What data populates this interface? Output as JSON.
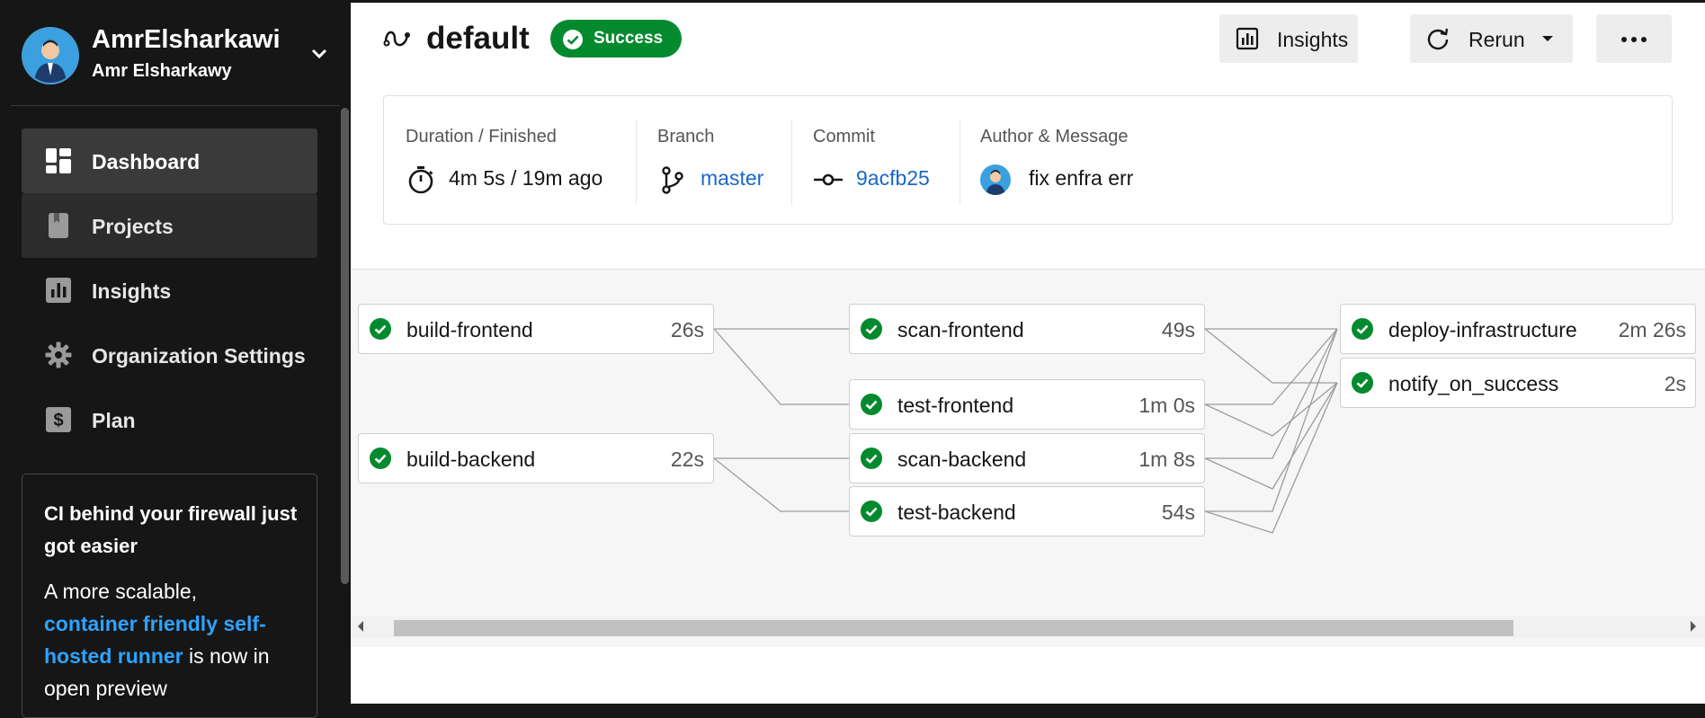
{
  "sidebar": {
    "org_name": "AmrElsharkawi",
    "user_name": "Amr Elsharkawy",
    "nav": [
      {
        "label": "Dashboard",
        "icon": "dashboard-icon"
      },
      {
        "label": "Projects",
        "icon": "projects-icon"
      },
      {
        "label": "Insights",
        "icon": "insights-icon"
      },
      {
        "label": "Organization Settings",
        "icon": "gear-icon"
      },
      {
        "label": "Plan",
        "icon": "dollar-icon"
      }
    ],
    "promo": {
      "title": "CI behind your firewall just got easier",
      "body_prefix": "A more scalable,",
      "link_text": "container friendly self-hosted runner",
      "body_suffix": " is now in open preview"
    }
  },
  "workflow": {
    "name": "default",
    "status": "Success",
    "status_color": "#048a2e"
  },
  "toolbar": {
    "insights_label": "Insights",
    "rerun_label": "Rerun"
  },
  "details": {
    "duration_label": "Duration / Finished",
    "duration_value": "4m 5s / 19m ago",
    "branch_label": "Branch",
    "branch_value": "master",
    "commit_label": "Commit",
    "commit_value": "9acfb25",
    "author_label": "Author & Message",
    "message_value": "fix enfra err"
  },
  "jobs": [
    {
      "name": "build-frontend",
      "duration": "26s"
    },
    {
      "name": "build-backend",
      "duration": "22s"
    },
    {
      "name": "scan-frontend",
      "duration": "49s"
    },
    {
      "name": "test-frontend",
      "duration": "1m 0s"
    },
    {
      "name": "scan-backend",
      "duration": "1m 8s"
    },
    {
      "name": "test-backend",
      "duration": "54s"
    },
    {
      "name": "deploy-infrastructure",
      "duration": "2m 26s"
    },
    {
      "name": "notify_on_success",
      "duration": "2s"
    }
  ]
}
